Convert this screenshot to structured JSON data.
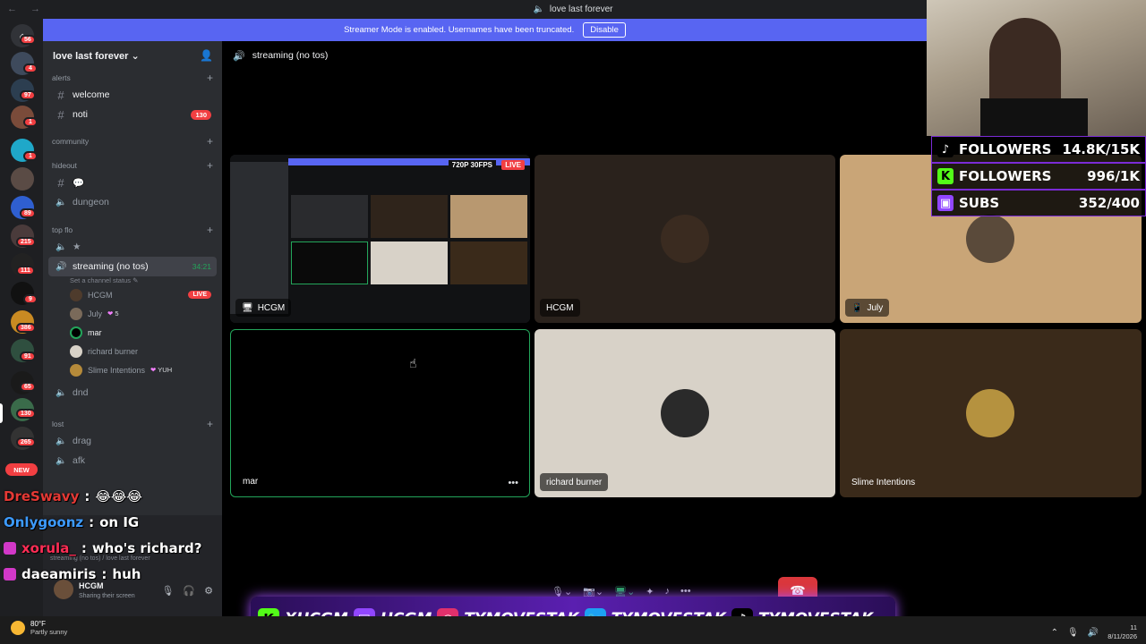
{
  "window": {
    "title": "love last forever"
  },
  "banner": {
    "text": "Streamer Mode is enabled. Usernames have been truncated.",
    "disable_label": "Disable"
  },
  "rail": {
    "badges": [
      "56",
      "4",
      "97",
      "1",
      "1",
      "89",
      "215",
      "111",
      "9",
      "386",
      "91",
      "65",
      "130",
      "265"
    ],
    "new_label": "NEW"
  },
  "server": {
    "name": "love last forever",
    "chevron": "chevron-down-icon"
  },
  "sidebar": {
    "cat_alerts": "alerts",
    "ch_welcome": "welcome",
    "ch_noti": "noti",
    "noti_badge": "130",
    "cat_community": "community",
    "cat_hideout": "hideout",
    "ch_bubble": "💬",
    "ch_dungeon": "dungeon",
    "cat_topflo": "top flo",
    "ch_star": "★",
    "ch_streaming": "streaming (no tos)",
    "streaming_timer": "34:21",
    "streaming_status": "Set a channel status",
    "voice_users": [
      {
        "name": "HCGM",
        "live": "LIVE"
      },
      {
        "name": "July",
        "tag": "5"
      },
      {
        "name": "mar"
      },
      {
        "name": "richard burner"
      },
      {
        "name": "Slime Intentions",
        "tag": "YUH"
      }
    ],
    "ch_dnd": "dnd",
    "cat_lost": "lost",
    "ch_drag": "drag",
    "ch_afk": "afk"
  },
  "user_panel": {
    "voice_status": "streaming (no tos) / love last forever",
    "name": "HCGM",
    "status": "Sharing their screen"
  },
  "main": {
    "channel_title": "streaming (no tos)",
    "tiles": [
      {
        "label": "HCGM",
        "stream_quality": "720P 30FPS",
        "live": "LIVE"
      },
      {
        "label": "HCGM"
      },
      {
        "label": "July"
      },
      {
        "label": "mar"
      },
      {
        "label": "richard burner"
      },
      {
        "label": "Slime Intentions"
      }
    ]
  },
  "overlay": {
    "stats": [
      {
        "icon": "tiktok-icon",
        "label": "FOLLOWERS",
        "value": "14.8K/15K",
        "color": "#000000"
      },
      {
        "icon": "kick-icon",
        "label": "FOLLOWERS",
        "value": "996/1K",
        "color": "#53fc18"
      },
      {
        "icon": "twitch-icon",
        "label": "SUBS",
        "value": "352/400",
        "color": "#9146ff"
      }
    ],
    "chat": [
      {
        "user": "DreSwavy",
        "msg": "😂😂😂",
        "color": "#e53935"
      },
      {
        "user": "Onlygoonz",
        "msg": "on IG",
        "color": "#3d9bff"
      },
      {
        "user": "xorula_",
        "msg": "who's richard?",
        "color": "#ff2d55"
      },
      {
        "user": "daeamiris",
        "msg": "huh",
        "color": "#ffffff"
      }
    ],
    "socials": [
      {
        "icon": "kick-icon",
        "handle": "XHCGM"
      },
      {
        "icon": "twitch-icon",
        "handle": "HCGM"
      },
      {
        "icon": "instagram-icon",
        "handle": "TYMOVESTAK"
      },
      {
        "icon": "twitter-icon",
        "handle": "TYMOVESTAK"
      },
      {
        "icon": "tiktok-icon",
        "handle": "TYMOVESTAK"
      }
    ]
  },
  "taskbar": {
    "temp": "80°F",
    "weather": "Partly sunny",
    "time": "11",
    "date": "8/11/2026"
  }
}
